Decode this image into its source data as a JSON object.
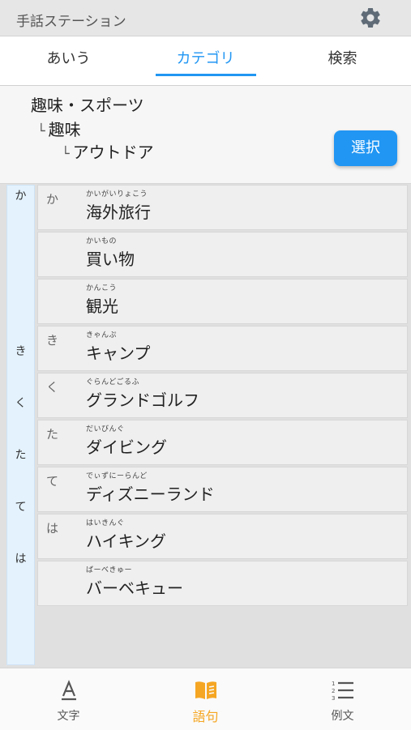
{
  "app": {
    "title": "手話ステーション",
    "icon": "gear-icon"
  },
  "tabs": [
    {
      "label": "あいう"
    },
    {
      "label": "カテゴリ",
      "active": true
    },
    {
      "label": "検索"
    }
  ],
  "breadcrumb": {
    "level1": "趣味・スポーツ",
    "level2": "趣味",
    "level3": "アウトドア",
    "branch": "└",
    "select_label": "選択"
  },
  "index": [
    "か",
    "き",
    "く",
    "た",
    "て",
    "は"
  ],
  "rows": [
    {
      "letter": "か",
      "ruby": "かいがいりょこう",
      "word": "海外旅行"
    },
    {
      "letter": "",
      "ruby": "かいもの",
      "word": "買い物"
    },
    {
      "letter": "",
      "ruby": "かんこう",
      "word": "観光"
    },
    {
      "letter": "き",
      "ruby": "きゃんぷ",
      "word": "キャンプ"
    },
    {
      "letter": "く",
      "ruby": "ぐらんどごるふ",
      "word": "グランドゴルフ"
    },
    {
      "letter": "た",
      "ruby": "だいびんぐ",
      "word": "ダイビング"
    },
    {
      "letter": "て",
      "ruby": "でぃずにーらんど",
      "word": "ディズニーランド"
    },
    {
      "letter": "は",
      "ruby": "はいきんぐ",
      "word": "ハイキング"
    },
    {
      "letter": "",
      "ruby": "ばーべきゅー",
      "word": "バーベキュー"
    }
  ],
  "bottom_nav": [
    {
      "label": "文字",
      "icon": "letter-a-icon"
    },
    {
      "label": "語句",
      "icon": "book-icon",
      "active": true
    },
    {
      "label": "例文",
      "icon": "numbered-list-icon"
    }
  ],
  "colors": {
    "accent": "#2196f3",
    "nav_active": "#f5a623",
    "index_bg": "#e3f2fd"
  }
}
